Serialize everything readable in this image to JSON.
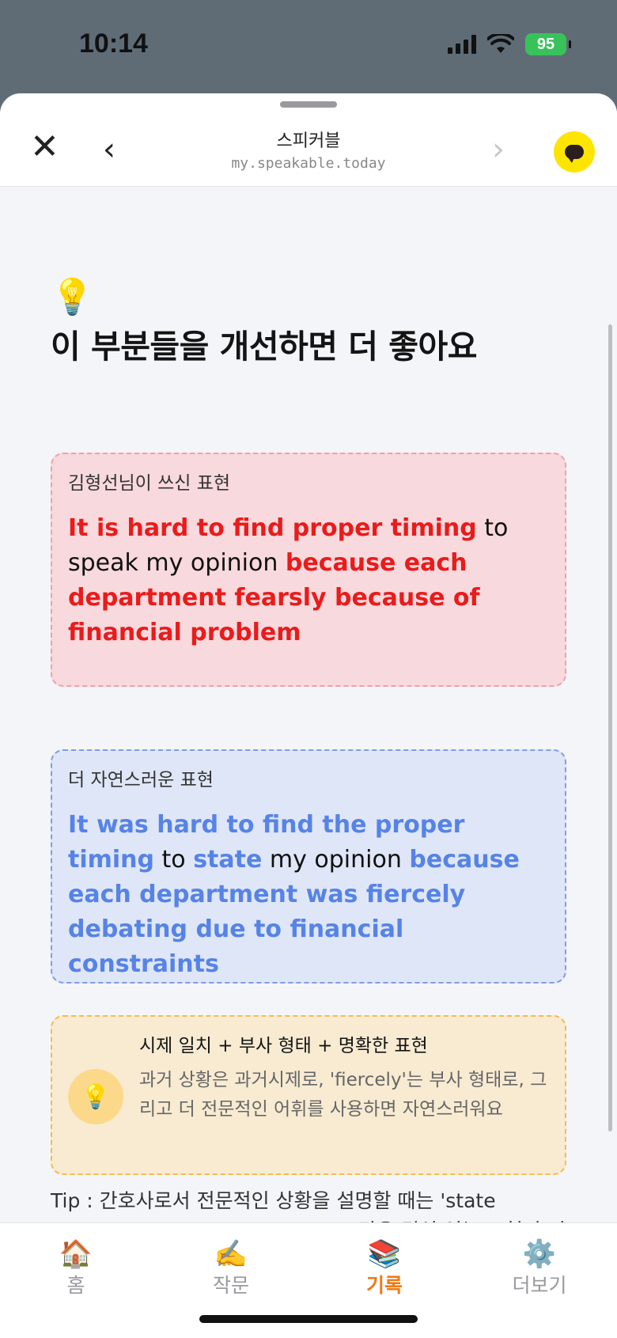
{
  "status": {
    "time": "10:14",
    "battery": "95"
  },
  "browser": {
    "title": "스피커블",
    "url": "my.speakable.today",
    "close_icon": "✕",
    "back_icon": "‹",
    "forward_icon": "›"
  },
  "page": {
    "heading_icon": "💡",
    "heading": "이 부분들을 개선하면 더 좋아요"
  },
  "original": {
    "label": "김형선님이 쓰신 표현",
    "segments": [
      {
        "text": "It is hard to find proper timing",
        "highlight": true
      },
      {
        "text": " to speak my opinion ",
        "highlight": false
      },
      {
        "text": "because each department fearsly because of financial problem",
        "highlight": true
      }
    ]
  },
  "natural": {
    "label": "더 자연스러운 표현",
    "segments": [
      {
        "text": "It was hard to find the proper timing",
        "highlight": true
      },
      {
        "text": " to ",
        "highlight": false
      },
      {
        "text": "state",
        "highlight": true
      },
      {
        "text": " my opinion ",
        "highlight": false
      },
      {
        "text": "because each department was fiercely debating due to financial constraints",
        "highlight": true
      }
    ]
  },
  "tip_card": {
    "icon": "💡",
    "title": "시제 일치 + 부사 형태 + 명확한 표현",
    "body": "과거 상황은 과거시제로, 'fiercely'는 부사 형태로, 그리고 더 전문적인 어휘를 사용하면 자연스러워요"
  },
  "tip_footer": "Tip : 간호사로서 전문적인 상황을 설명할 때는 'state opinion', 'financial constraints' 같은 격식 있는 표현이 더 적합해요",
  "tabs": [
    {
      "icon": "🏠",
      "label": "홈",
      "active": false
    },
    {
      "icon": "✍️",
      "label": "작문",
      "active": false
    },
    {
      "icon": "📚",
      "label": "기록",
      "active": true
    },
    {
      "icon": "⚙️",
      "label": "더보기",
      "active": false
    }
  ],
  "colors": {
    "original_highlight": "#ea1b1b",
    "natural_highlight": "#5683e6",
    "active_tab": "#f07a17"
  }
}
